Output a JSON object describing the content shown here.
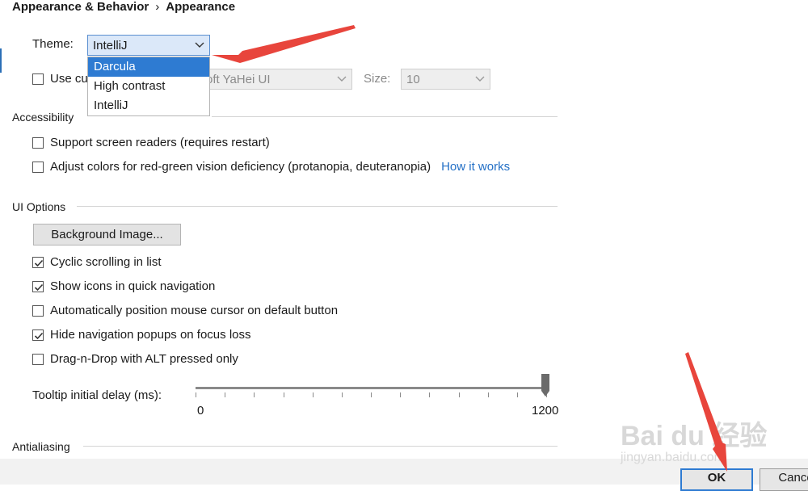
{
  "breadcrumb": {
    "parent": "Appearance & Behavior",
    "separator": "›",
    "current": "Appearance"
  },
  "theme": {
    "label": "Theme:",
    "selected": "IntelliJ",
    "options": [
      "Darcula",
      "High contrast",
      "IntelliJ"
    ],
    "highlighted": "Darcula"
  },
  "custom_font": {
    "checkbox_label_visible": "Use cu",
    "font_value_visible": "oft YaHei UI",
    "size_label": "Size:",
    "size_value": "10",
    "checked": false
  },
  "accessibility": {
    "title": "Accessibility",
    "screen_readers": {
      "label": "Support screen readers (requires restart)",
      "checked": false
    },
    "color_adjust": {
      "label": "Adjust colors for red-green vision deficiency (protanopia, deuteranopia)",
      "checked": false,
      "link": "How it works"
    }
  },
  "ui_options": {
    "title": "UI Options",
    "bg_image_button": "Background Image...",
    "options": [
      {
        "label": "Cyclic scrolling in list",
        "checked": true
      },
      {
        "label": "Show icons in quick navigation",
        "checked": true
      },
      {
        "label": "Automatically position mouse cursor on default button",
        "checked": false
      },
      {
        "label": "Hide navigation popups on focus loss",
        "checked": true
      },
      {
        "label": "Drag-n-Drop with ALT pressed only",
        "checked": false
      }
    ],
    "tooltip": {
      "label": "Tooltip initial delay (ms):",
      "min": "0",
      "max": "1200",
      "value_fraction": 1.0
    }
  },
  "antialiasing": {
    "title": "Antialiasing"
  },
  "footer": {
    "ok": "OK",
    "cancel_visible": "Cance"
  },
  "watermark": {
    "logo": "Bai du 经验",
    "url": "jingyan.baidu.com"
  },
  "colors": {
    "accent": "#2e7bd2",
    "link": "#2470c6",
    "arrow": "#e8453c"
  }
}
